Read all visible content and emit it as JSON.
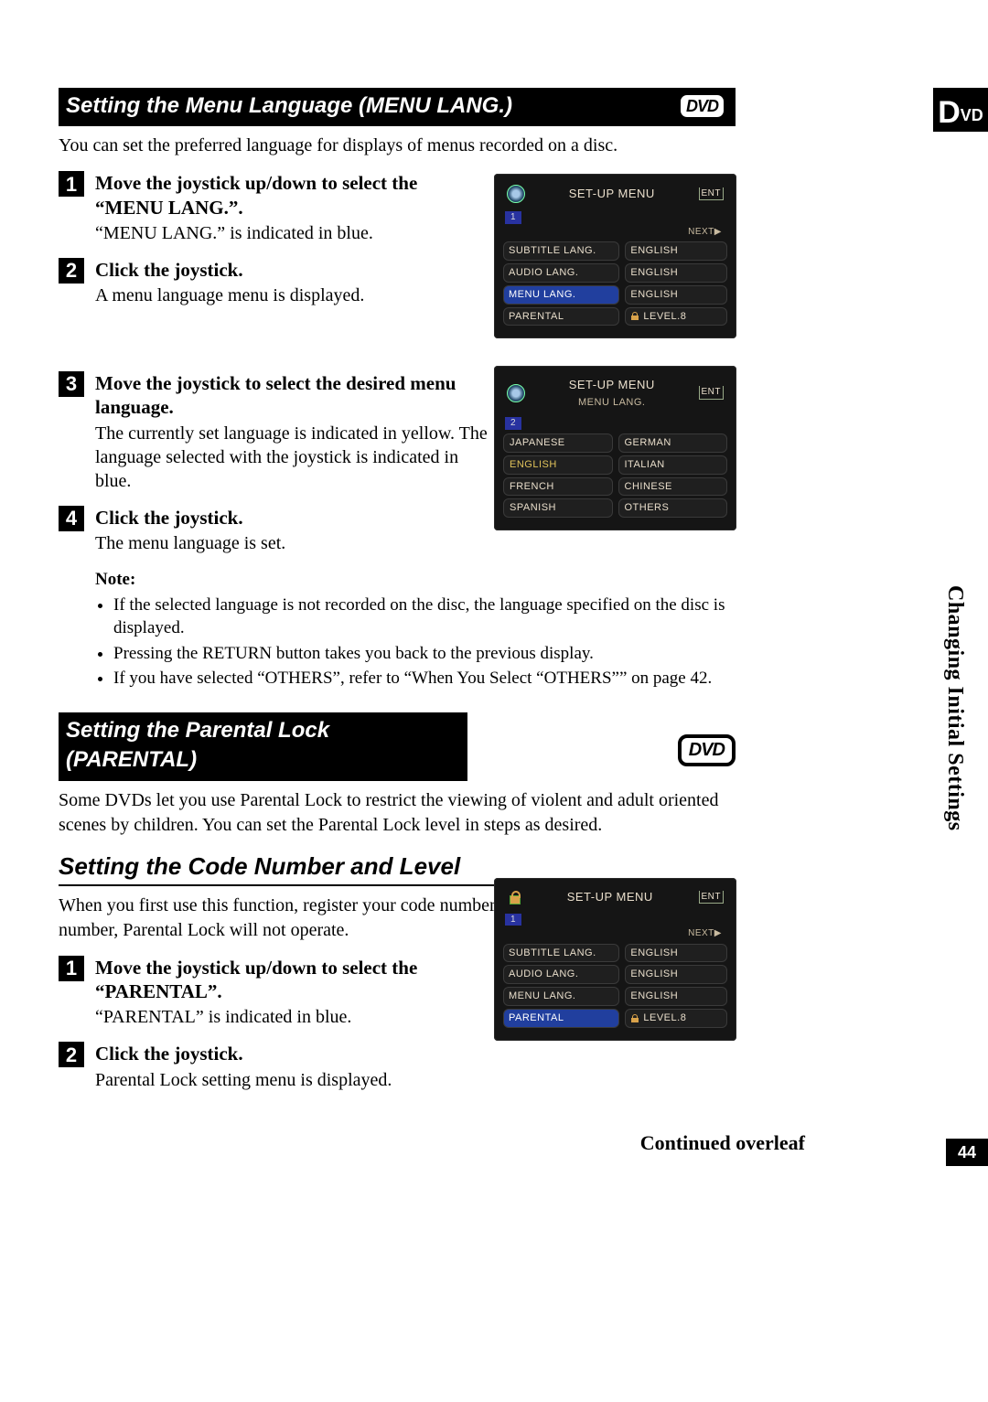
{
  "side_tab": {
    "big": "D",
    "sub": "VD"
  },
  "vertical_title": "Changing Initial Settings",
  "page_number": "44",
  "continued": "Continued overleaf",
  "section1": {
    "headline": "Setting the Menu Language (MENU LANG.)",
    "dvd_badge": "DVD",
    "intro": "You can set the preferred language for displays of menus recorded on a disc.",
    "steps": [
      {
        "n": "1",
        "title": "Move the joystick up/down to select the “MENU LANG.”.",
        "body": "“MENU LANG.” is indicated in blue."
      },
      {
        "n": "2",
        "title": "Click the joystick.",
        "body": "A menu language menu is displayed."
      },
      {
        "n": "3",
        "title": "Move the joystick to select the desired menu language.",
        "body": "The currently set language is indicated in yellow. The language selected with the joystick is indicated in blue."
      },
      {
        "n": "4",
        "title": "Click the joystick.",
        "body": "The menu language is set."
      }
    ],
    "note_title": "Note:",
    "notes": [
      "If the selected language is not recorded on the disc, the language specified on the disc is displayed.",
      "Pressing the RETURN button takes you back to the previous display.",
      "If you have selected “OTHERS”, refer to “When You Select “OTHERS”” on page 42."
    ]
  },
  "section2": {
    "headline": "Setting the Parental Lock (PARENTAL)",
    "dvd_badge": "DVD",
    "intro": "Some DVDs let you use Parental Lock to restrict the viewing of violent and adult oriented scenes by children. You can set the Parental Lock level in steps as desired.",
    "subhead": "Setting the Code Number and Level",
    "sub_intro": "When you first use this function, register your code number. If you do not register a code number, Parental Lock will not operate.",
    "steps": [
      {
        "n": "1",
        "title": "Move the joystick up/down to select the “PARENTAL”.",
        "body": "“PARENTAL” is indicated in blue."
      },
      {
        "n": "2",
        "title": "Click the joystick.",
        "body": "Parental Lock setting menu is displayed."
      }
    ]
  },
  "screen1": {
    "title": "SET-UP MENU",
    "ent": "ENT",
    "tab": "1",
    "next": "NEXT▶",
    "rows": [
      {
        "l": "SUBTITLE LANG.",
        "r": "ENGLISH"
      },
      {
        "l": "AUDIO LANG.",
        "r": "ENGLISH"
      },
      {
        "l": "MENU LANG.",
        "r": "ENGLISH",
        "hl": true
      },
      {
        "l": "PARENTAL",
        "r": "LEVEL.8",
        "lock": true
      }
    ]
  },
  "screen2": {
    "title": "SET-UP MENU",
    "sub": "MENU LANG.",
    "ent": "ENT",
    "tab": "2",
    "rows": [
      {
        "l": "JAPANESE",
        "r": "GERMAN"
      },
      {
        "l": "ENGLISH",
        "r": "ITALIAN",
        "yl": true
      },
      {
        "l": "FRENCH",
        "r": "CHINESE"
      },
      {
        "l": "SPANISH",
        "r": "OTHERS"
      }
    ]
  },
  "screen3": {
    "title": "SET-UP MENU",
    "ent": "ENT",
    "tab": "1",
    "next": "NEXT▶",
    "rows": [
      {
        "l": "SUBTITLE LANG.",
        "r": "ENGLISH"
      },
      {
        "l": "AUDIO LANG.",
        "r": "ENGLISH"
      },
      {
        "l": "MENU LANG.",
        "r": "ENGLISH"
      },
      {
        "l": "PARENTAL",
        "r": "LEVEL.8",
        "hl": true,
        "lock": true
      }
    ]
  }
}
